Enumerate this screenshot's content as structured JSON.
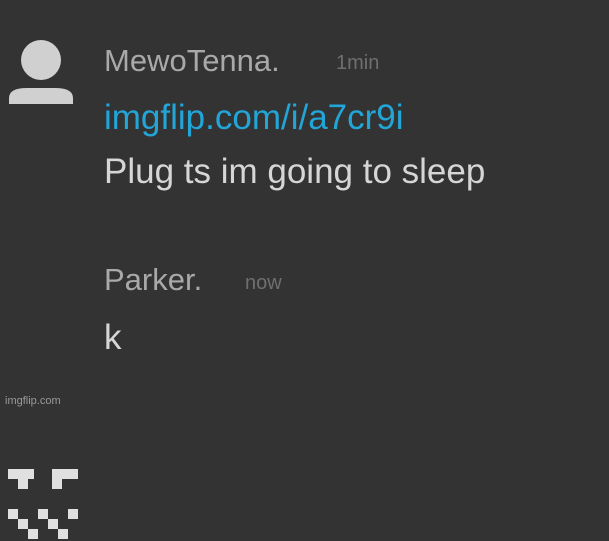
{
  "comments": [
    {
      "avatar_icon": "default-user-icon",
      "username": "MewoTenna.",
      "time": "1min",
      "link": "imgflip.com/i/a7cr9i",
      "text": "Plug ts im going to sleep"
    },
    {
      "avatar_icon": "pixel-face-icon",
      "username": "Parker.",
      "time": "now",
      "text": "k"
    }
  ],
  "watermark": "imgflip.com",
  "colors": {
    "background": "#333333",
    "username": "#a9a9a9",
    "time": "#6f6f6f",
    "link": "#22a6d8",
    "text": "#d6d6d6",
    "avatar_default": "#d0d0d0",
    "avatar_pixel": "#e0e0e0"
  }
}
